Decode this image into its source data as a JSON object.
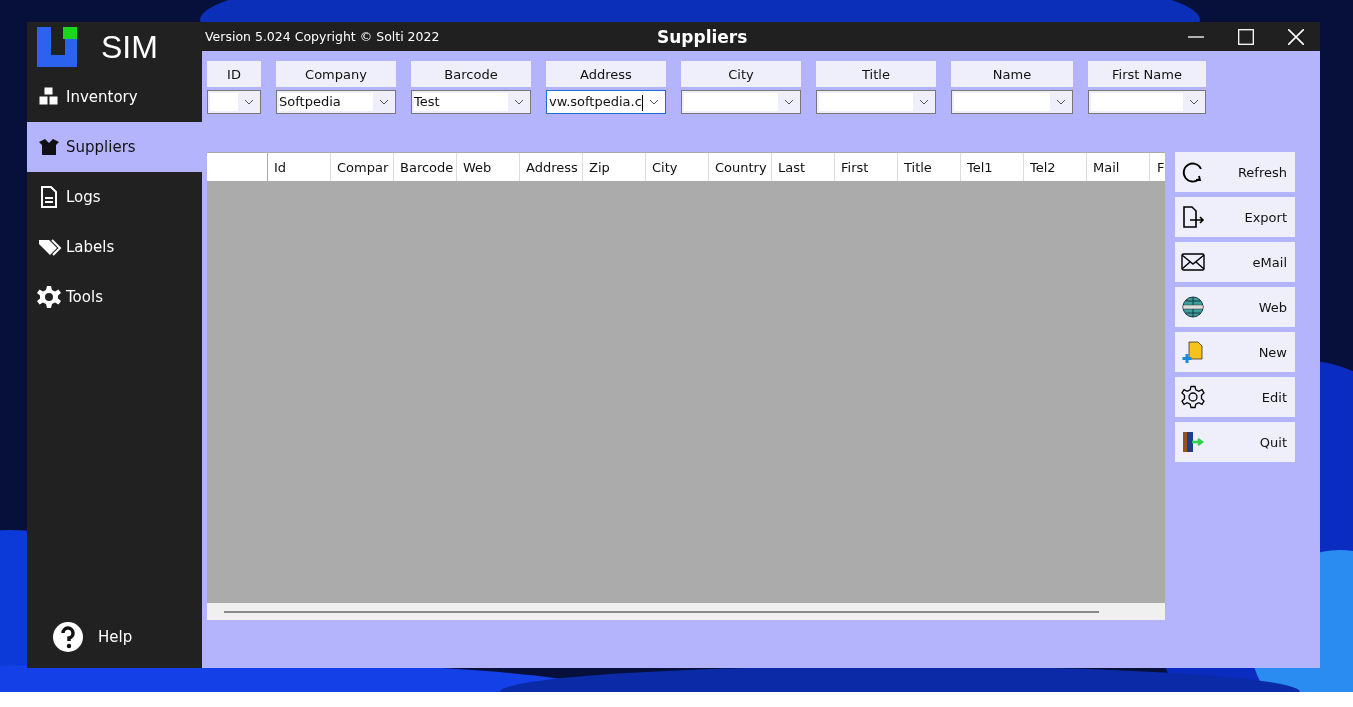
{
  "app": {
    "logo_text": "SIM",
    "version": "Version 5.024  Copyright © Solti 2022"
  },
  "window": {
    "title": "Suppliers"
  },
  "sidebar": {
    "items": [
      {
        "label": "Inventory",
        "selected": false
      },
      {
        "label": "Suppliers",
        "selected": true
      },
      {
        "label": "Logs",
        "selected": false
      },
      {
        "label": "Labels",
        "selected": false
      },
      {
        "label": "Tools",
        "selected": false
      }
    ],
    "help": "Help"
  },
  "filters": [
    {
      "label": "ID",
      "focused": false
    },
    {
      "label": "Company",
      "value": "Softpedia",
      "focused": false
    },
    {
      "label": "Barcode",
      "value": "Test",
      "focused": false
    },
    {
      "label": "Address",
      "value": "vw.softpedia.c",
      "focused": true
    },
    {
      "label": "City",
      "focused": false
    },
    {
      "label": "Title",
      "focused": false
    },
    {
      "label": "Name",
      "focused": false
    },
    {
      "label": "First Name",
      "focused": false
    }
  ],
  "table": {
    "columns": [
      "Id",
      "Compar",
      "Barcode",
      "Web",
      "Address",
      "Zip",
      "City",
      "Country",
      "Last",
      "First",
      "Title",
      "Tel1",
      "Tel2",
      "Mail",
      "F"
    ]
  },
  "buttons": [
    {
      "label": "Refresh"
    },
    {
      "label": "Export"
    },
    {
      "label": "eMail"
    },
    {
      "label": "Web"
    },
    {
      "label": "New"
    },
    {
      "label": "Edit"
    },
    {
      "label": "Quit"
    }
  ]
}
